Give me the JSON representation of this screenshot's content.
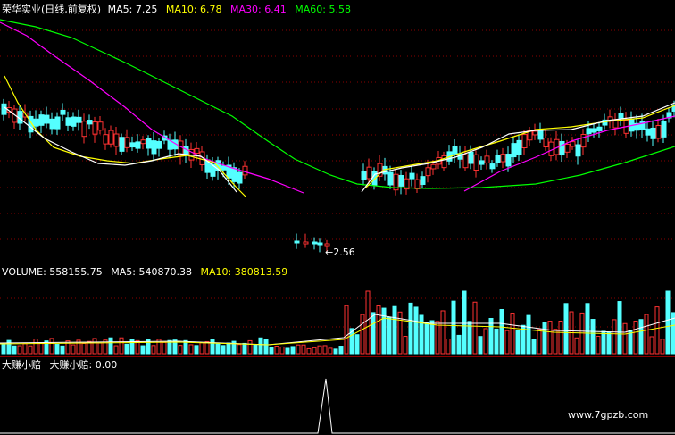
{
  "header": {
    "stock_name": "荣华实业(日线,前复权)",
    "ma5": {
      "label": "MA5:",
      "value": "7.25",
      "color": "#ffffff"
    },
    "ma10": {
      "label": "MA10:",
      "value": "6.78",
      "color": "#ffff00"
    },
    "ma30": {
      "label": "MA30:",
      "value": "6.41",
      "color": "#ff00ff"
    },
    "ma60": {
      "label": "MA60:",
      "value": "5.58",
      "color": "#00ff00"
    }
  },
  "price_panel": {
    "low_marker": "←2.56"
  },
  "volume_panel": {
    "volume": {
      "label": "VOLUME:",
      "value": "558155.75"
    },
    "ma5": {
      "label": "MA5:",
      "value": "540870.38"
    },
    "ma10": {
      "label": "MA10:",
      "value": "380813.59"
    }
  },
  "indicator_panel": {
    "name": "大赚小赔",
    "line_label": "大赚小赔:",
    "line_value": "0.00"
  },
  "watermark": "www.7gpzb.com",
  "colors": {
    "up": "#ff3232",
    "down": "#54ffff",
    "grid": "#8a0000",
    "background": "#000000"
  }
}
